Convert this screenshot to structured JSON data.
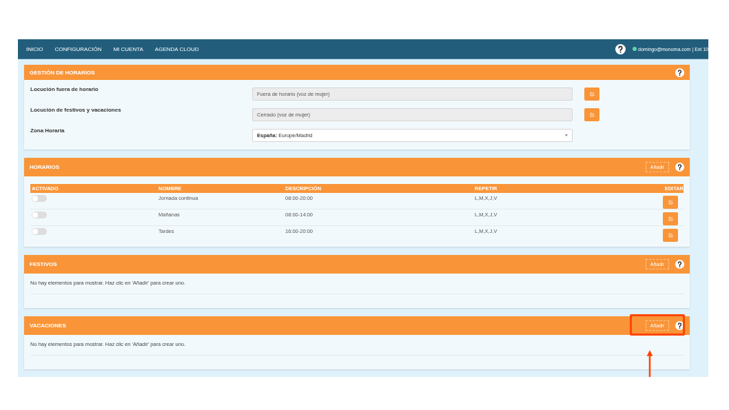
{
  "nav": {
    "items": [
      {
        "label": "INICIO"
      },
      {
        "label": "CONFIGURACIÓN"
      },
      {
        "label": "MI CUENTA"
      },
      {
        "label": "AGENDA CLOUD"
      }
    ],
    "user": {
      "text": "domingo@monoma.com | Ext 10",
      "online": true
    }
  },
  "sections": [
    {
      "kind": "form",
      "title": "GESTIÓN DE HORARIOS",
      "highlighted": false,
      "fields": [
        {
          "kind": "readonly",
          "label": "Locución fuera de horario",
          "value": "Fuera de horario (voz de mujer)"
        },
        {
          "kind": "readonly",
          "label": "Locución de festivos y vacaciones",
          "value": "Cerrado (voz de mujer)"
        },
        {
          "kind": "select",
          "label": "Zona Horaria",
          "value": "**España:** Europe/Madrid"
        }
      ]
    },
    {
      "kind": "table",
      "title": "HORARIOS",
      "add_label": "Añadir",
      "highlighted": false,
      "columns": [
        "ACTIVADO",
        "NOMBRE",
        "DESCRIPCIÓN",
        "REPETIR",
        "EDITAR"
      ],
      "rows": [
        {
          "on": false,
          "name": "Jornada continua",
          "description": "08:00-20:00",
          "repeat": "L,M,X,J,V"
        },
        {
          "on": false,
          "name": "Mañanas",
          "description": "08:00-14:00",
          "repeat": "L,M,X,J,V"
        },
        {
          "on": false,
          "name": "Tardes",
          "description": "16:00-20:00",
          "repeat": "L,M,X,J,V"
        }
      ]
    },
    {
      "kind": "empty",
      "title": "FESTIVOS",
      "add_label": "Añadir",
      "highlighted": false,
      "message": "No hay elementos para mostrar. Haz clic en 'Añadir' para crear uno."
    },
    {
      "kind": "empty",
      "title": "VACACIONES",
      "add_label": "Añadir",
      "highlighted": true,
      "message": "No hay elementos para mostrar. Haz clic en 'Añadir' para crear uno."
    }
  ]
}
